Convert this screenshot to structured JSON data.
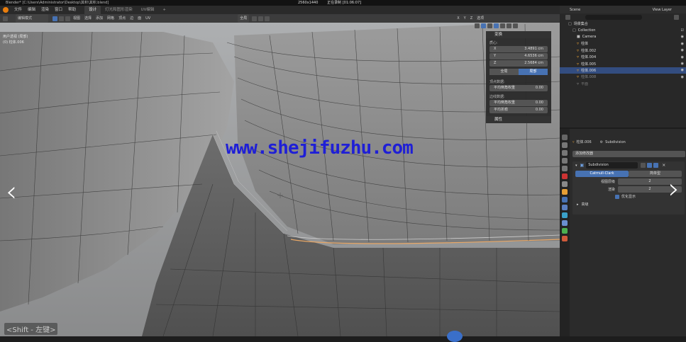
{
  "titlebar": {
    "title": "Blender* [C:\\Users\\Administrator\\Desktop\\其积\\其积.blend]",
    "resolution": "2560x1440",
    "recording": "正在录制 [01:06:07]"
  },
  "menus": [
    "文件",
    "编辑",
    "渲染",
    "窗口",
    "帮助"
  ],
  "workspace_tabs": [
    "设计",
    "灯光和图形渲染",
    "UV编辑"
  ],
  "scene": {
    "label": "Scene",
    "view_layer": "View Layer"
  },
  "viewport": {
    "mode": "编辑模式",
    "header_menus": [
      "视图",
      "选择",
      "添加",
      "网格",
      "顶点",
      "边",
      "面",
      "UV"
    ],
    "transform_orientation": "全局",
    "options_label": "选项",
    "axes": [
      "X",
      "Y",
      "Z"
    ],
    "view_name": "用户透视 (局部)",
    "object_name": "(0) 柱体.006",
    "shift_hint": "<Shift - 左键>"
  },
  "npanel": {
    "header": "变换",
    "median_label": "质心:",
    "fields": [
      {
        "axis": "X",
        "value": "3.4891 cm"
      },
      {
        "axis": "Y",
        "value": "4.6536 cm"
      },
      {
        "axis": "Z",
        "value": "2.5684 cm"
      }
    ],
    "seg": [
      "全局",
      "局部"
    ],
    "vertex_data_label": "顶点数据:",
    "vertex_bevel": {
      "label": "平均倒角权重",
      "value": "0.00"
    },
    "edge_data_label": "边线数据:",
    "edge_bevel": {
      "label": "平均倒角权重",
      "value": "0.00"
    },
    "edge_crease": {
      "label": "平均折痕",
      "value": "0.00"
    },
    "properties_label": "属性"
  },
  "outliner": {
    "root": "场景集合",
    "collection": "Collection",
    "items": [
      {
        "name": "Camera",
        "selected": false
      },
      {
        "name": "柱体",
        "selected": false
      },
      {
        "name": "柱体.002",
        "selected": false
      },
      {
        "name": "柱体.004",
        "selected": false
      },
      {
        "name": "柱体.005",
        "selected": false
      },
      {
        "name": "柱体.006",
        "selected": true
      },
      {
        "name": "柱体.008",
        "selected": false
      },
      {
        "name": "平面",
        "selected": false
      }
    ]
  },
  "properties": {
    "object": "柱体.006",
    "modifier_type": "Subdivision",
    "add_modifier": "添加修改器",
    "modifier_name": "Subdivision",
    "algo": [
      "Catmull-Clark",
      "简单型"
    ],
    "levels_viewport": {
      "label": "视图层级",
      "value": "2"
    },
    "render": {
      "label": "渲染",
      "value": "2"
    },
    "optimal_display": "优化显示",
    "advanced": "高级"
  },
  "watermark": "www.shejifuzhu.com",
  "colors": {
    "accent": "#4772b3",
    "selected_row": "#334d80",
    "mesh_icon": "#e69f35",
    "watermark": "#1f1fd6"
  }
}
